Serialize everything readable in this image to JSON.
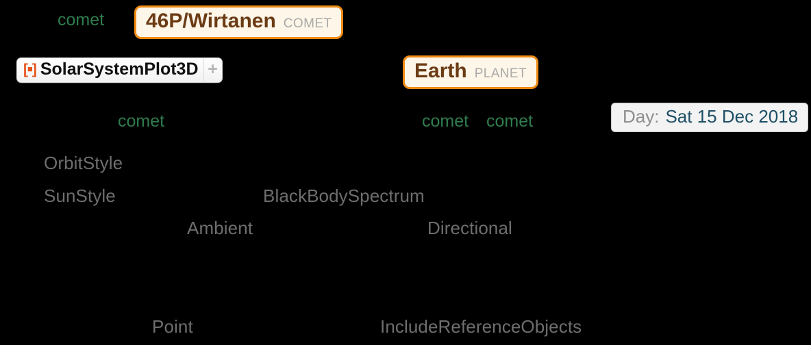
{
  "cell": {
    "background": "#000000",
    "accent_orange": "#ef8a12",
    "variable_green": "#2f7d4e",
    "symbol_gray": "#6e6e6e",
    "date_value_color": "#1d4f66"
  },
  "line1": {
    "variable": "comet",
    "entity": {
      "name": "46P/Wirtanen",
      "type": "COMET"
    }
  },
  "line2": {
    "resource_function": {
      "icon": "resource-function-icon",
      "label": "SolarSystemPlot3D",
      "plus": "+"
    },
    "entity": {
      "name": "Earth",
      "type": "PLANET"
    }
  },
  "line3": {
    "variable_1": "comet",
    "variable_2": "comet",
    "variable_3": "comet",
    "date": {
      "label": "Day:",
      "value": "Sat 15 Dec 2018"
    }
  },
  "options": {
    "orbit_style": "OrbitStyle",
    "sun_style": "SunStyle",
    "black_body_spectrum": "BlackBodySpectrum",
    "ambient": "Ambient",
    "directional": "Directional",
    "point": "Point",
    "include_reference_objects": "IncludeReferenceObjects"
  }
}
